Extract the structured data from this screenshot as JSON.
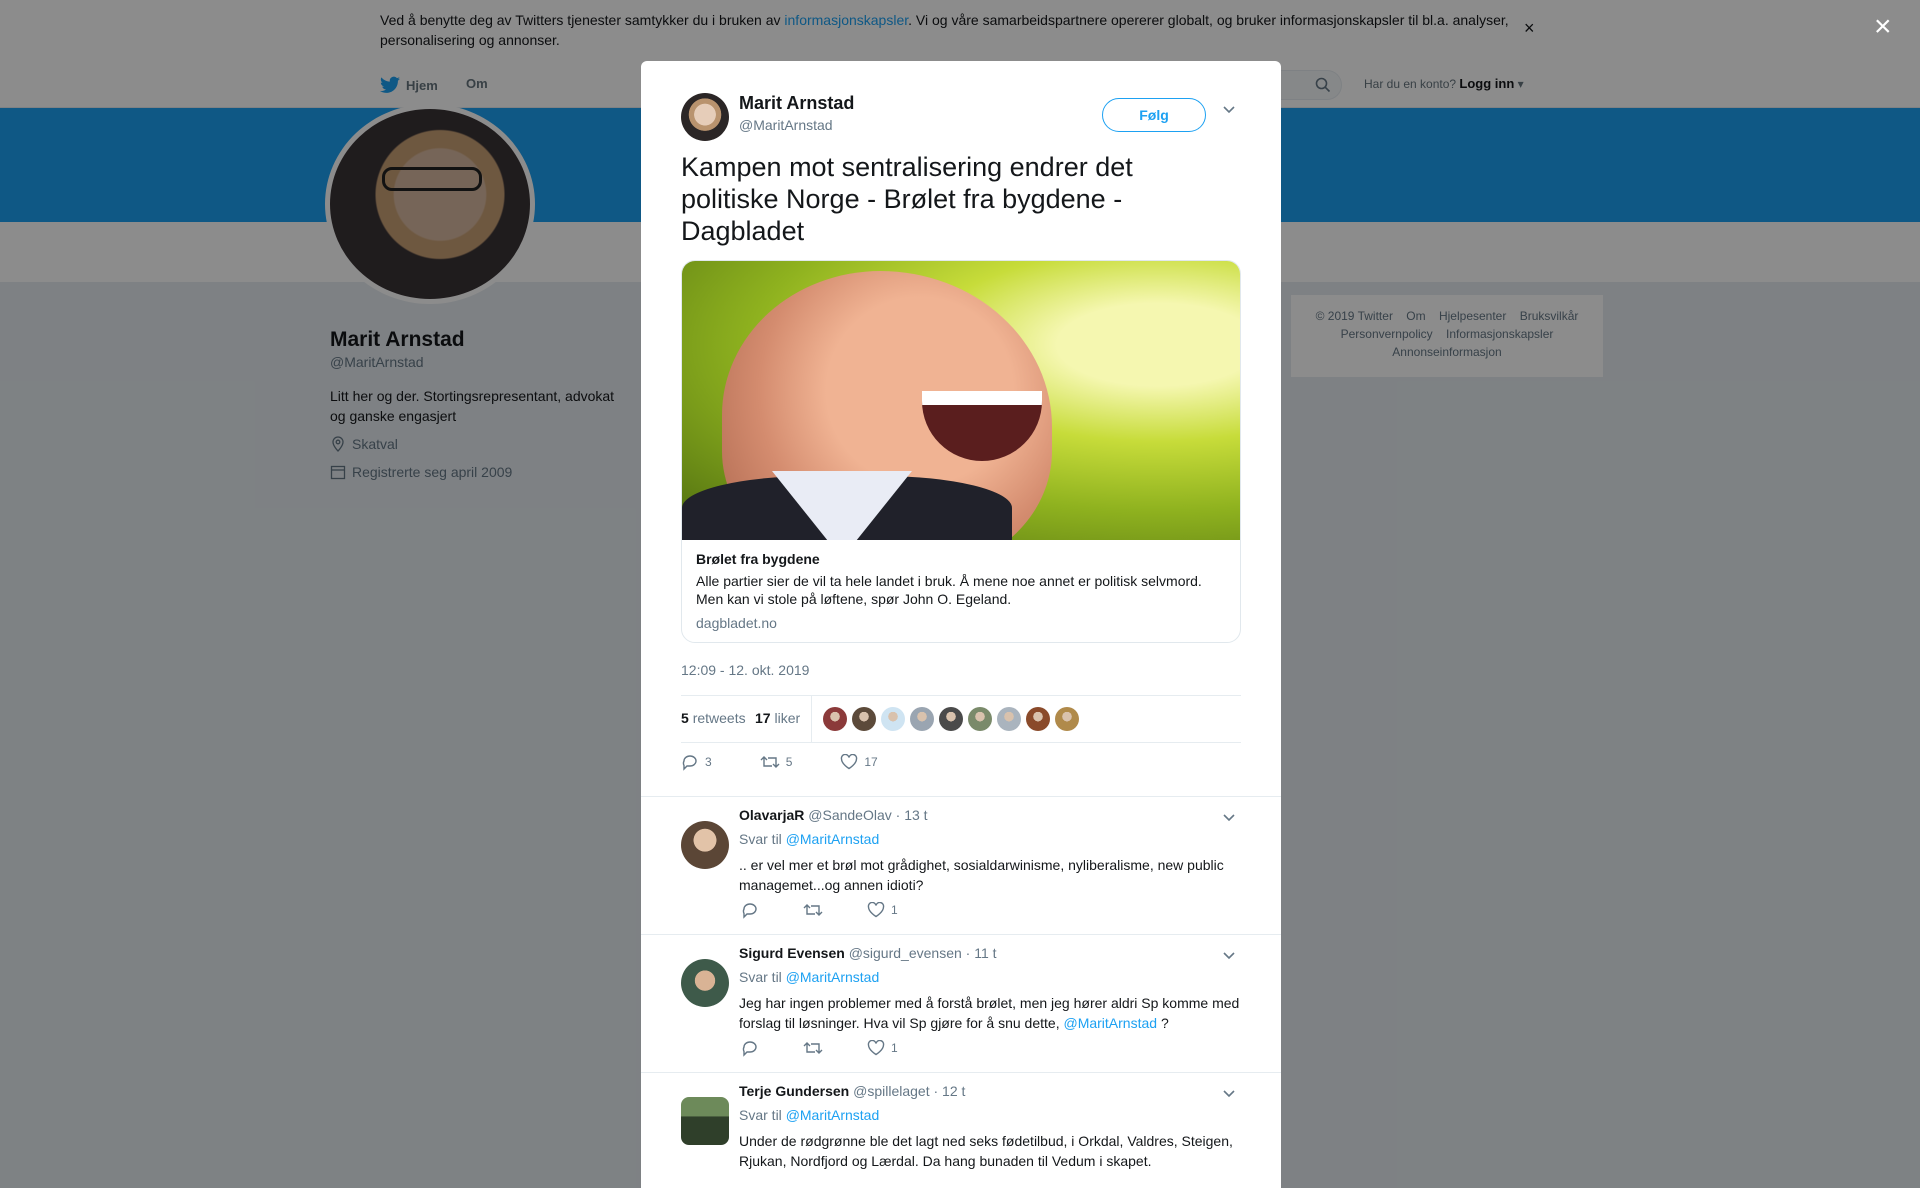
{
  "cookie_bar": {
    "text_before": "Ved å benytte deg av Twitters tjenester samtykker du i bruken av ",
    "link": "informasjonskapsler",
    "text_after": ". Vi og våre samarbeidspartnere opererer globalt, og bruker informasjonskapsler til bl.a. analyser, personalisering og annonser.",
    "close": "×"
  },
  "topnav": {
    "home": "Hjem",
    "about": "Om",
    "has_account": "Har du en konto?",
    "login": "Logg inn"
  },
  "profile": {
    "name": "Marit Arnstad",
    "handle": "@MaritArnstad",
    "bio": "Litt her og der. Stortingsrepresentant, advokat og ganske engasjert",
    "location": "Skatval",
    "joined": "Registrerte seg april 2009"
  },
  "footer": {
    "links": [
      "© 2019 Twitter",
      "Om",
      "Hjelpesenter",
      "Bruksvilkår",
      "Personvernpolicy",
      "Informasjonskapsler",
      "Annonseinformasjon"
    ]
  },
  "overlay_close": "×",
  "tweet": {
    "name": "Marit Arnstad",
    "handle": "@MaritArnstad",
    "follow": "Følg",
    "text": "Kampen mot sentralisering endrer det politiske Norge - Brølet fra bygdene - Dagbladet",
    "card": {
      "title": "Brølet fra bygdene",
      "description": "Alle partier sier de vil ta hele landet i bruk. Å mene noe annet er politisk selvmord. Men kan vi stole på løftene, spør John O. Egeland.",
      "domain": "dagbladet.no"
    },
    "timestamp": "12:09 - 12. okt. 2019",
    "retweets_count": "5",
    "retweets_label": "retweets",
    "likes_count": "17",
    "likes_label": "liker",
    "liker_colors": [
      "#8b3a3a",
      "#5c4a3a",
      "#cfe4f2",
      "#9aa5b1",
      "#4a4a4a",
      "#7a8a6a",
      "#aab4be",
      "#8a4a2a",
      "#b08a4a"
    ],
    "actions": {
      "reply": "3",
      "retweet": "5",
      "like": "17"
    }
  },
  "replies": [
    {
      "name": "OlavarjaR",
      "handle": "@SandeOlav",
      "time": "· 13 t",
      "reply_to_label": "Svar til",
      "reply_to": "@MaritArnstad",
      "text": ".. er vel mer et brøl mot grådighet, sosialdarwinisme, nyliberalisme, new public managemet...og annen idioti?",
      "likes": "1",
      "avatar_color": "#5b4636"
    },
    {
      "name": "Sigurd Evensen",
      "handle": "@sigurd_evensen",
      "time": "· 11 t",
      "reply_to_label": "Svar til",
      "reply_to": "@MaritArnstad",
      "text": "Jeg har ingen problemer med å forstå brølet, men jeg hører aldri Sp komme med forslag til løsninger. Hva vil Sp gjøre for å snu dette, ",
      "mention": "@MaritArnstad",
      "text_end": " ?",
      "likes": "1",
      "avatar_color": "#3e5a4a"
    },
    {
      "name": "Terje Gundersen",
      "handle": "@spillelaget",
      "time": "· 12 t",
      "reply_to_label": "Svar til",
      "reply_to": "@MaritArnstad",
      "text": "Under de rødgrønne ble det lagt ned seks fødetilbud, i Orkdal, Valdres, Steigen, Rjukan, Nordfjord og Lærdal. Da hang bunaden til Vedum i skapet.",
      "likes": "",
      "avatar_color": "#2f3f2a"
    }
  ]
}
